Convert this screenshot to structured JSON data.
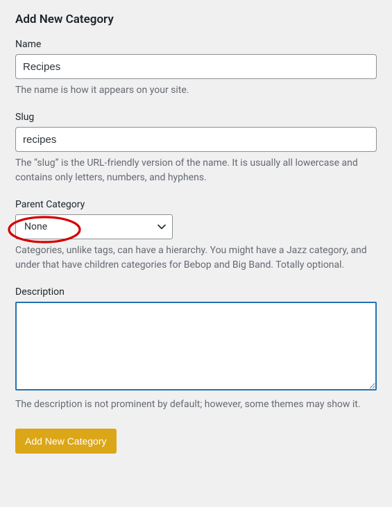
{
  "heading": "Add New Category",
  "fields": {
    "name": {
      "label": "Name",
      "value": "Recipes",
      "help": "The name is how it appears on your site."
    },
    "slug": {
      "label": "Slug",
      "value": "recipes",
      "help": "The “slug” is the URL-friendly version of the name. It is usually all lowercase and contains only letters, numbers, and hyphens."
    },
    "parent": {
      "label": "Parent Category",
      "selected": "None",
      "help": "Categories, unlike tags, can have a hierarchy. You might have a Jazz category, and under that have children categories for Bebop and Big Band. Totally optional."
    },
    "description": {
      "label": "Description",
      "value": "",
      "help": "The description is not prominent by default; however, some themes may show it."
    }
  },
  "submit_label": "Add New Category",
  "annotation": {
    "highlight_color": "#d40000"
  }
}
